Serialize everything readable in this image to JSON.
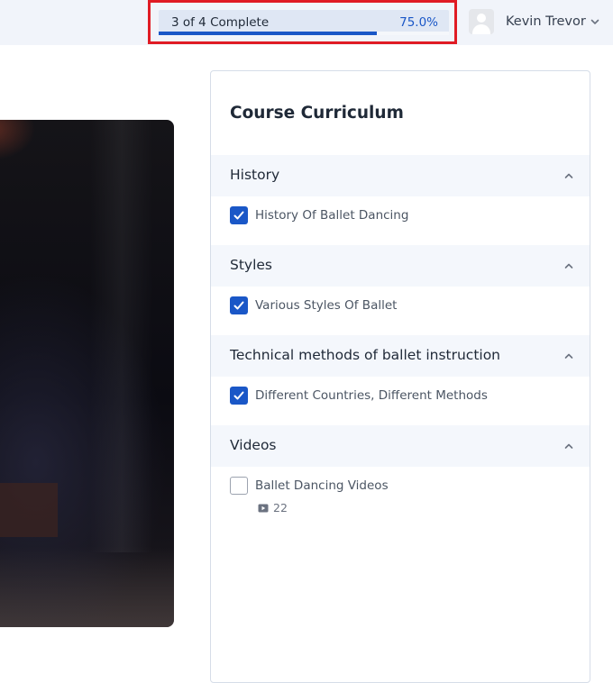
{
  "progress": {
    "label": "3 of 4 Complete",
    "percent_text": "75.0%",
    "fraction": 0.75,
    "highlight_color": "#e01b24",
    "accent_color": "#1a57c7"
  },
  "user": {
    "name": "Kevin Trevor",
    "avatar_icon": "user-silhouette-icon",
    "chevron_icon": "chevron-down-icon"
  },
  "curriculum": {
    "title": "Course Curriculum",
    "sections": [
      {
        "title": "History",
        "expanded": true,
        "lessons": [
          {
            "label": "History Of Ballet Dancing",
            "completed": true
          }
        ]
      },
      {
        "title": "Styles",
        "expanded": true,
        "lessons": [
          {
            "label": "Various Styles Of Ballet",
            "completed": true
          }
        ]
      },
      {
        "title": "Technical methods of ballet instruction",
        "expanded": true,
        "lessons": [
          {
            "label": "Different Countries, Different Methods",
            "completed": true
          }
        ]
      },
      {
        "title": "Videos",
        "expanded": true,
        "lessons": [
          {
            "label": "Ballet Dancing Videos",
            "completed": false,
            "video_count": "22",
            "meta_icon": "video-icon"
          }
        ]
      }
    ]
  }
}
